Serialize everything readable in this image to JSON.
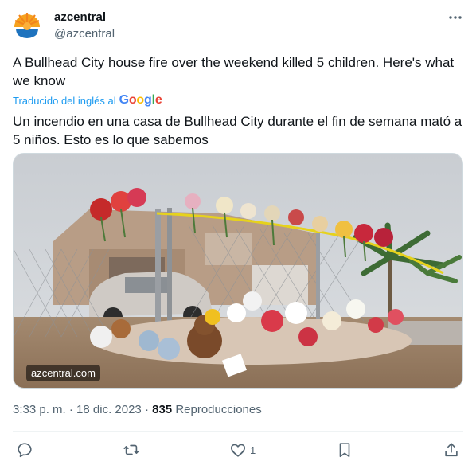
{
  "author": {
    "name": "azcentral",
    "handle": "@azcentral"
  },
  "tweet": {
    "text": "A Bullhead City house fire over the weekend killed 5 children. Here's what we know",
    "translated_label": "Traducido del inglés al",
    "translated_brand": "Google",
    "translation": "Un incendio en una casa de Bullhead City durante el fin de semana mató a 5 niños. Esto es lo que sabemos"
  },
  "media": {
    "watermark": "azcentral.com"
  },
  "meta": {
    "time": "3:33 p. m.",
    "separator": "·",
    "date": "18 dic. 2023",
    "views_count": "835",
    "views_label": "Reproducciones"
  },
  "actions": {
    "like_count": "1"
  },
  "colors": {
    "accent": "#1d9bf0",
    "secondary_text": "#536471"
  }
}
